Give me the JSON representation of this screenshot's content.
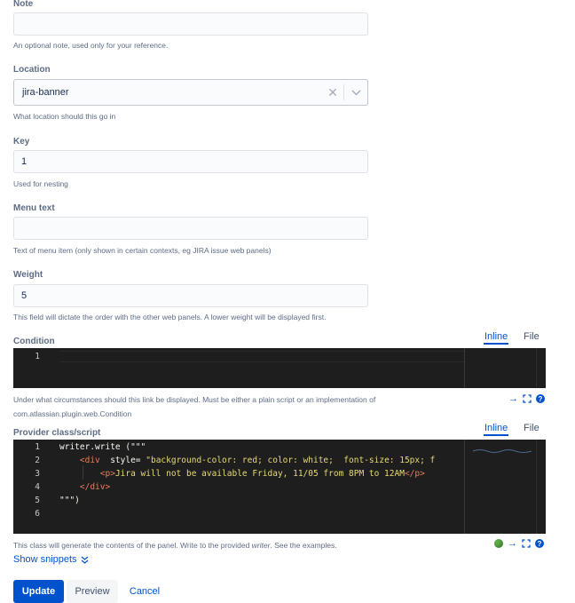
{
  "note": {
    "label": "Note",
    "value": "",
    "help": "An optional note, used only for your reference."
  },
  "location": {
    "label": "Location",
    "value": "jira-banner",
    "help": "What location should this go in"
  },
  "key": {
    "label": "Key",
    "value": "1",
    "help": "Used for nesting"
  },
  "menu_text": {
    "label": "Menu text",
    "value": "",
    "help": "Text of menu item (only shown in certain contexts, eg JIRA issue web panels)"
  },
  "weight": {
    "label": "Weight",
    "value": "5",
    "help": "This field will dictate the order with the other web panels. A lower weight will be displayed first."
  },
  "condition": {
    "label": "Condition",
    "tabs": [
      "Inline",
      "File"
    ],
    "active_tab": "Inline",
    "line_numbers": [
      "1"
    ],
    "help_line1": "Under what circumstances should this link be displayed. Must be either a plain script or an implementation of",
    "help_line2": "com.atlassian.plugin.web.Condition"
  },
  "provider": {
    "label": "Provider class/script",
    "tabs": [
      "Inline",
      "File"
    ],
    "active_tab": "Inline",
    "line_numbers": [
      "1",
      "2",
      "3",
      "4",
      "5",
      "6"
    ],
    "code": {
      "l1": "writer.write (\"\"\"",
      "l2_a": "    <div  ",
      "l2_b": "style=",
      "l2_c": " \"background-color: red; color: white;  font-size: 15px; f",
      "l3_a": "        <p>",
      "l3_b": "Jira will not be available Friday, 11/05 from 8PM to 12AM",
      "l3_c": "</p>",
      "l4": "    </div>",
      "l5": "\"\"\")",
      "l6": ""
    },
    "help_prefix": "This class will generate the contents of the panel. Write to the provided ",
    "help_em": "writer",
    "help_suffix": ". See the examples."
  },
  "show_snippets": "Show snippets",
  "buttons": {
    "update": "Update",
    "preview": "Preview",
    "cancel": "Cancel"
  },
  "colors": {
    "primary": "#0052cc",
    "editor_bg": "#1e1e1e",
    "status_ok": "#5aac44"
  }
}
